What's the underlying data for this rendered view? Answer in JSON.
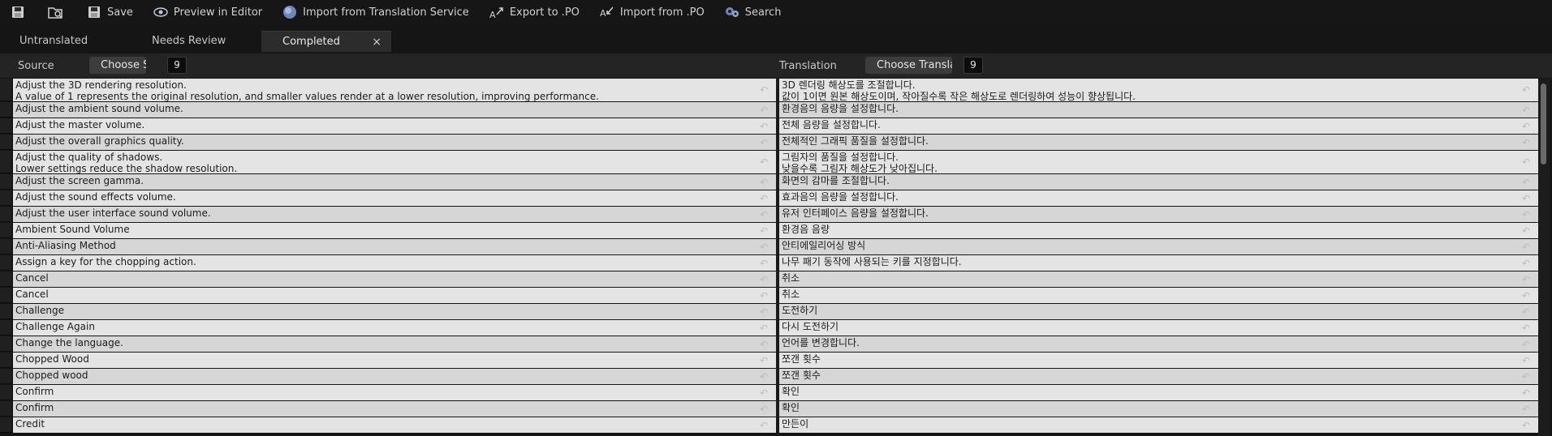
{
  "toolbar": {
    "save_label": "Save",
    "preview_label": "Preview in Editor",
    "import_translation_label": "Import from Translation Service",
    "export_po_label": "Export to .PO",
    "import_po_label": "Import from .PO",
    "search_label": "Search"
  },
  "tabs": {
    "untranslated": "Untranslated",
    "needs_review": "Needs Review",
    "completed": "Completed",
    "close_glyph": "×"
  },
  "header": {
    "source_label": "Source",
    "choose_source_label": "Choose Source",
    "source_count": "9",
    "translation_label": "Translation",
    "choose_translation_label": "Choose Translation",
    "translation_count": "9"
  },
  "rows": [
    {
      "source": "Adjust the 3D rendering resolution.\nA value of 1 represents the original resolution, and smaller values render at a lower resolution, improving performance.",
      "translation": "3D 렌더링 해상도를 조절합니다.\n값이 1이면 원본 해상도이며, 작아질수록 작은 해상도로 렌더링하여 성능이 향상됩니다."
    },
    {
      "source": "Adjust the ambient sound volume.",
      "translation": "환경음의 음량을 설정합니다."
    },
    {
      "source": "Adjust the master volume.",
      "translation": "전체 음량을 설정합니다."
    },
    {
      "source": "Adjust the overall graphics quality.",
      "translation": "전체적인 그래픽 품질을 설정합니다."
    },
    {
      "source": "Adjust the quality of shadows.\nLower settings reduce the shadow resolution.",
      "translation": "그림자의 품질을 설정합니다.\n낮을수록 그림자 해상도가 낮아집니다."
    },
    {
      "source": "Adjust the screen gamma.",
      "translation": "화면의 감마를 조절합니다."
    },
    {
      "source": "Adjust the sound effects volume.",
      "translation": "효과음의 음량을 설정합니다."
    },
    {
      "source": "Adjust the user interface sound volume.",
      "translation": "유저 인터페이스 음량을 설정합니다."
    },
    {
      "source": "Ambient Sound Volume",
      "translation": "환경음 음량"
    },
    {
      "source": "Anti-Aliasing Method",
      "translation": "안티에일리어싱 방식"
    },
    {
      "source": "Assign a key for the chopping action.",
      "translation": "나무 패기 동작에 사용되는 키를 지정합니다."
    },
    {
      "source": "Cancel",
      "translation": "취소"
    },
    {
      "source": "Cancel",
      "translation": "취소"
    },
    {
      "source": "Challenge",
      "translation": "도전하기"
    },
    {
      "source": "Challenge Again",
      "translation": "다시 도전하기"
    },
    {
      "source": "Change the language.",
      "translation": "언어를 변경합니다."
    },
    {
      "source": "Chopped Wood",
      "translation": "쪼갠 횟수"
    },
    {
      "source": "Chopped wood",
      "translation": "쪼갠 횟수"
    },
    {
      "source": "Confirm",
      "translation": "확인"
    },
    {
      "source": "Confirm",
      "translation": "확인"
    },
    {
      "source": "Credit",
      "translation": "만든이"
    }
  ],
  "icons": {
    "revert": "↶"
  }
}
